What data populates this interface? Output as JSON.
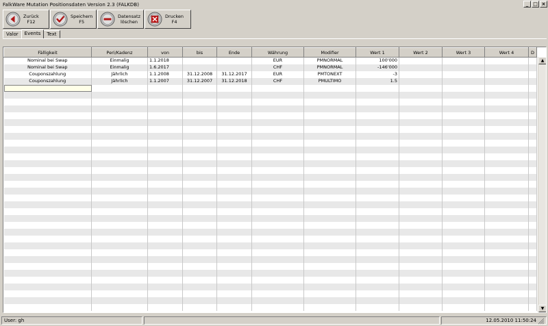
{
  "window": {
    "title": "FalkWare   Mutation Positionsdaten   Version 2.3  (FALKDB)",
    "minimize": "_",
    "maximize": "□",
    "close": "×"
  },
  "toolbar": {
    "buttons": [
      {
        "label": "Zurück\nF12",
        "icon": "back-arrow-icon"
      },
      {
        "label": "Speichern\nF5",
        "icon": "checkmark-icon"
      },
      {
        "label": "Datensatz\nlöschen",
        "icon": "minus-icon"
      },
      {
        "label": "Drucken\nF4",
        "icon": "print-x-icon"
      }
    ]
  },
  "tabs": [
    {
      "label": "Valor",
      "active": false
    },
    {
      "label": "Events",
      "active": true
    },
    {
      "label": "Text",
      "active": false
    }
  ],
  "grid": {
    "columns": [
      "Fälligkeit",
      "Peri/Kadenz",
      "von",
      "bis",
      "Ende",
      "Währung",
      "Modifier",
      "Wert 1",
      "Wert 2",
      "Wert 3",
      "Wert 4",
      "D"
    ],
    "rows": [
      [
        "Nominal bei Swap",
        "Einmalig",
        "1.1.2018",
        "",
        "",
        "EUR",
        "PMNORMAL",
        "100'000",
        "",
        "",
        "",
        ""
      ],
      [
        "Nominal bei Swap",
        "Einmalig",
        "1.6.2017",
        "",
        "",
        "CHF",
        "PMNORMAL",
        "-146'000",
        "",
        "",
        "",
        ""
      ],
      [
        "Couponszahlung",
        "Jährlich",
        "1.1.2008",
        "31.12.2008",
        "31.12.2017",
        "EUR",
        "PMTONEXT",
        "-3",
        "",
        "",
        "",
        ""
      ],
      [
        "Couponszahlung",
        "Jährlich",
        "1.1.2007",
        "31.12.2007",
        "31.12.2018",
        "CHF",
        "PMULTIMO",
        "1.5",
        "",
        "",
        "",
        ""
      ]
    ]
  },
  "scrollbar": {
    "up": "▲",
    "down": "▼"
  },
  "status": {
    "user": "User: gh",
    "datetime": "12.05.2010 11:50:24"
  }
}
